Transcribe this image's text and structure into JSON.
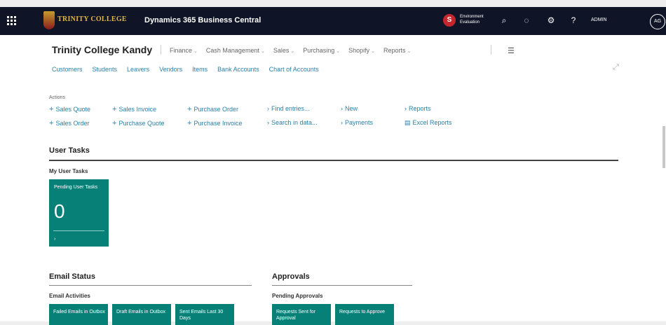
{
  "topbar": {
    "logo_text": "TRINITY COLLEGE",
    "app_title": "Dynamics 365 Business Central",
    "env_badge": "S",
    "env_text": "Environment Evaluation",
    "user": "ADMIN",
    "avatar_initials": "AG"
  },
  "company": "Trinity College Kandy",
  "menu": [
    {
      "label": "Finance"
    },
    {
      "label": "Cash Management"
    },
    {
      "label": "Sales"
    },
    {
      "label": "Purchasing"
    },
    {
      "label": "Shopify"
    },
    {
      "label": "Reports"
    }
  ],
  "links": [
    "Customers",
    "Students",
    "Leavers",
    "Vendors",
    "Items",
    "Bank Accounts",
    "Chart of Accounts"
  ],
  "actions_label": "Actions",
  "actions": {
    "sales_quote": "Sales Quote",
    "sales_invoice": "Sales Invoice",
    "purchase_order": "Purchase Order",
    "find_entries": "Find entries...",
    "new": "New",
    "reports": "Reports",
    "sales_order": "Sales Order",
    "purchase_quote": "Purchase Quote",
    "purchase_invoice": "Purchase Invoice",
    "search_in_data": "Search in data...",
    "payments": "Payments",
    "excel_reports": "Excel Reports"
  },
  "user_tasks": {
    "title": "User Tasks",
    "subtitle": "My User Tasks",
    "tile_label": "Pending User Tasks",
    "tile_value": "0"
  },
  "email_status": {
    "title": "Email Status",
    "subtitle": "Email Activities",
    "tiles": [
      "Failed Emails in Outbox",
      "Draft Emails in Outbox",
      "Sent Emails Last 30 Days"
    ]
  },
  "approvals": {
    "title": "Approvals",
    "subtitle": "Pending Approvals",
    "tiles": [
      "Requests Sent for Approval",
      "Requests to Approve"
    ]
  },
  "colors": {
    "topbar": "#0f1526",
    "tile": "#078078",
    "link": "#2a7fa6"
  }
}
